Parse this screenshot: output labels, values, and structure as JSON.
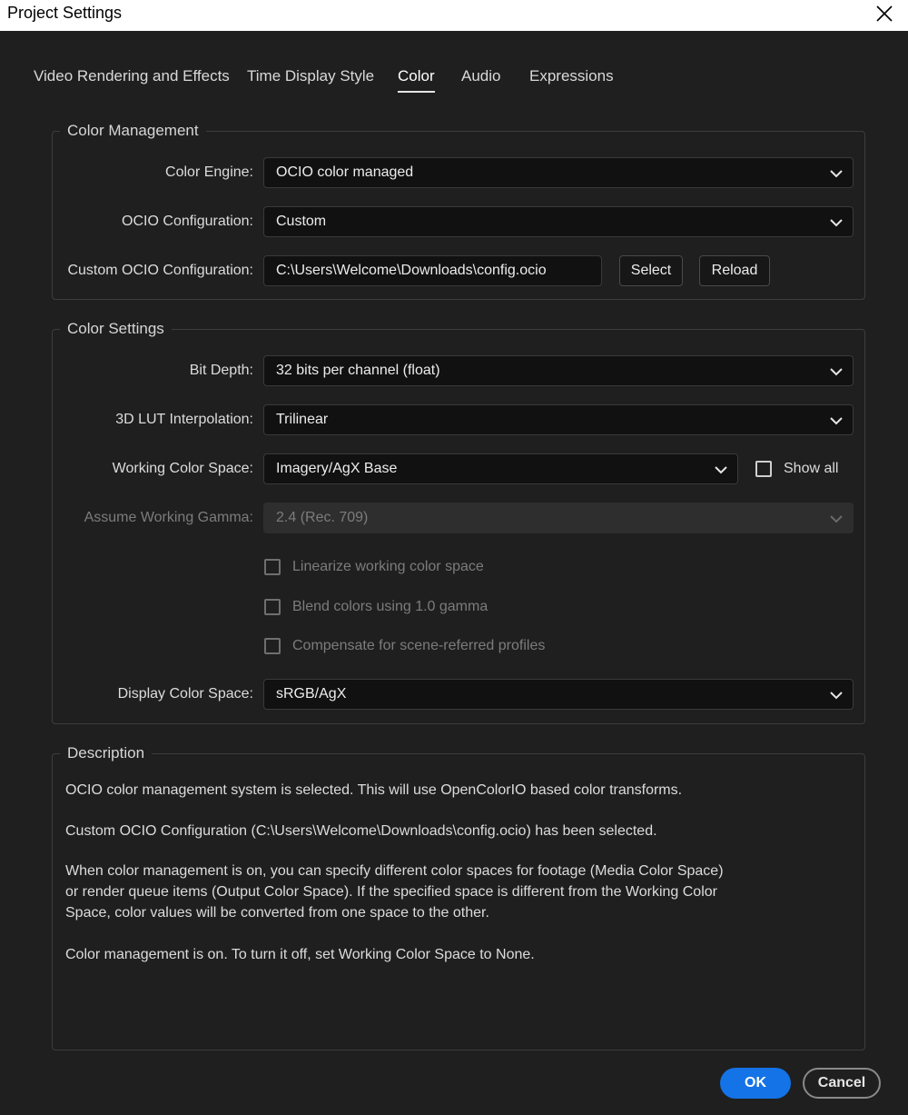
{
  "window": {
    "title": "Project Settings"
  },
  "tabs": [
    {
      "label": "Video Rendering and Effects"
    },
    {
      "label": "Time Display Style"
    },
    {
      "label": "Color"
    },
    {
      "label": "Audio"
    },
    {
      "label": "Expressions"
    }
  ],
  "active_tab": "Color",
  "color_management": {
    "legend": "Color Management",
    "color_engine": {
      "label": "Color Engine:",
      "value": "OCIO color managed"
    },
    "ocio_configuration": {
      "label": "OCIO Configuration:",
      "value": "Custom"
    },
    "custom_ocio": {
      "label": "Custom OCIO Configuration:",
      "value": "C:\\Users\\Welcome\\Downloads\\config.ocio",
      "select_label": "Select",
      "reload_label": "Reload"
    }
  },
  "color_settings": {
    "legend": "Color Settings",
    "bit_depth": {
      "label": "Bit Depth:",
      "value": "32 bits per channel (float)"
    },
    "lut_interpolation": {
      "label": "3D LUT Interpolation:",
      "value": "Trilinear"
    },
    "working_color_space": {
      "label": "Working Color Space:",
      "value": "Imagery/AgX Base",
      "show_all_label": "Show all"
    },
    "working_gamma": {
      "label": "Assume Working Gamma:",
      "value": "2.4 (Rec. 709)"
    },
    "checkboxes": {
      "linearize": "Linearize working color space",
      "blend": "Blend colors using 1.0 gamma",
      "compensate": "Compensate for scene-referred profiles"
    },
    "display_color_space": {
      "label": "Display Color Space:",
      "value": "sRGB/AgX"
    }
  },
  "description": {
    "legend": "Description",
    "p1": "OCIO color management system is selected. This will use OpenColorIO based color transforms.",
    "p2": "Custom OCIO Configuration (C:\\Users\\Welcome\\Downloads\\config.ocio) has been selected.",
    "p3_line1": "When color management is on, you can specify different color spaces for footage (Media Color Space)",
    "p3_line2": "or render queue items (Output Color Space). If the specified space is different from the Working Color",
    "p3_line3": "Space, color values will be converted from one space to the other.",
    "p4": "Color management is on. To turn it off, set Working Color Space to None."
  },
  "footer": {
    "ok_label": "OK",
    "cancel_label": "Cancel"
  },
  "colors": {
    "accent": "#1473e6",
    "background": "#1f1f1f",
    "field_bg": "#111111"
  }
}
